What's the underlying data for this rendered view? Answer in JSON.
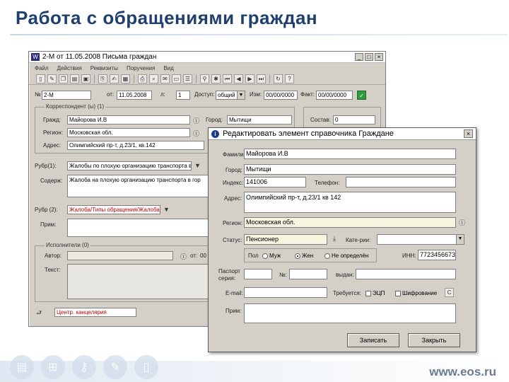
{
  "slide": {
    "title": "Работа с обращениями граждан",
    "site": "www.eos.ru"
  },
  "main_window": {
    "title": "2-М от 11.05.2008 Письма граждан",
    "menu": [
      "Файл",
      "Действия",
      "Реквизиты",
      "",
      "Поручения",
      "Вид"
    ],
    "fields": {
      "num_label": "№",
      "num_value": "2-М",
      "from_label": "от:",
      "from_value": "11.05.2008",
      "list_label": "л:",
      "list_value": "1",
      "access_label": "Доступ:",
      "access_value": "общий",
      "date_label": "Изм:",
      "date_value": "00/00/0000",
      "fact_label": "Факт:",
      "fact_value": "00/00/0000",
      "sender_group": "Корреспондент (ы) (1)",
      "citizen_label": "Гражд:",
      "citizen_value": "Майорова И.В",
      "city_label": "Город:",
      "city_value": "Мытищи",
      "state_label": "Состав:",
      "state_value": "0",
      "region_label": "Регион:",
      "region_value": "Московская обл.",
      "address_label": "Адрес:",
      "address_value": "Олимпийский пр-т, д.23/1, кв.142",
      "rubric_label": "Рубр(1):",
      "rubric_value": "Жалобы по плохую организацию транспорта в г...",
      "content_label": "Содерж:",
      "content_value": "Жалоба на плохую организацию транспорта в гор",
      "send_label": "Рубр (2):",
      "send_value": "Жалоба/Типы обращения/Жалоба",
      "prim_label": "Прим:",
      "executor_group": "Исполнители (0)",
      "author_label": "Автор:",
      "from2_label": "от:",
      "from2_value": "00",
      "text_label": "Текст:",
      "bottom_value": "Центр. канцелярия"
    }
  },
  "dialog": {
    "title": "Редактировать элемент справочника Граждане",
    "surname_label": "Фамилия:",
    "surname_value": "Майорова И.В",
    "city_label": "Город:",
    "city_value": "Мытищи",
    "index_label": "Индекс:",
    "index_value": "141006",
    "phone_label": "Телефон:",
    "address_label": "Адрес:",
    "address_value": "Олимпийский пр-т, д.23/1 кв 142",
    "region_label": "Регион:",
    "region_value": "Московская обл.",
    "status_label": "Статус:",
    "status_value": "Пенсионер",
    "category_label": "Кате-рии:",
    "gender_label": "Пол",
    "gender_male": "Муж",
    "gender_female": "Жен",
    "gender_undefined": "Не определён",
    "inn_label": "ИНН:",
    "inn_value": "7723456673",
    "passport_label": "Паспорт серия:",
    "passport_num_label": "№:",
    "issued_label": "выдан:",
    "email_label": "E-mail:",
    "required_label": "Требуется:",
    "eds_label": "ЭЦП",
    "encrypt_label": "Шифрование",
    "note_label": "Прим:",
    "save_button": "Записать",
    "close_button": "Закрыть"
  }
}
